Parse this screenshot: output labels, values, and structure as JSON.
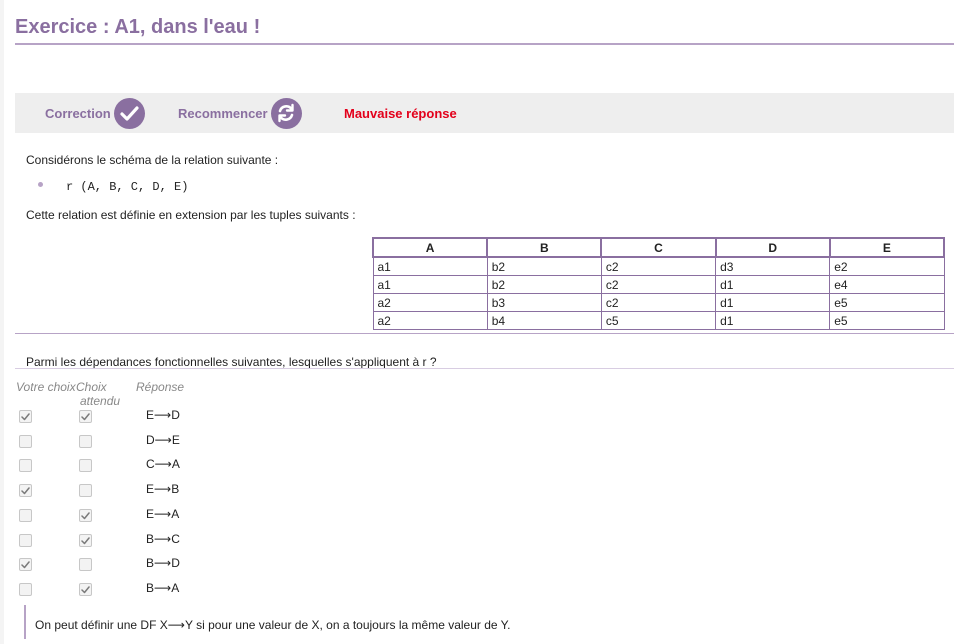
{
  "title": "Exercice : A1, dans l'eau !",
  "toolbar": {
    "correction_label": "Correction",
    "restart_label": "Recommencer",
    "status": "Mauvaise réponse"
  },
  "content": {
    "intro": "Considérons le schéma de la relation suivante :",
    "schema": "r (A, B, C, D, E)",
    "extension_text": "Cette relation est définie en extension par les tuples suivants :",
    "table": {
      "headers": [
        "A",
        "B",
        "C",
        "D",
        "E"
      ],
      "rows": [
        [
          "a1",
          "b2",
          "c2",
          "d3",
          "e2"
        ],
        [
          "a1",
          "b2",
          "c2",
          "d1",
          "e4"
        ],
        [
          "a2",
          "b3",
          "c2",
          "d1",
          "e5"
        ],
        [
          "a2",
          "b4",
          "c5",
          "d1",
          "e5"
        ]
      ]
    }
  },
  "question": {
    "text": "Parmi les dépendances fonctionnelles suivantes, lesquelles s'appliquent à r ?",
    "col_your_choice": "Votre choix",
    "col_expected_line1": "Choix",
    "col_expected_line2": "attendu",
    "col_answer": "Réponse",
    "answers": [
      {
        "label": "E⟶D",
        "your_choice": true,
        "expected": true
      },
      {
        "label": "D⟶E",
        "your_choice": false,
        "expected": false
      },
      {
        "label": "C⟶A",
        "your_choice": false,
        "expected": false
      },
      {
        "label": "E⟶B",
        "your_choice": true,
        "expected": false
      },
      {
        "label": "E⟶A",
        "your_choice": false,
        "expected": true
      },
      {
        "label": "B⟶C",
        "your_choice": false,
        "expected": true
      },
      {
        "label": "B⟶D",
        "your_choice": true,
        "expected": false
      },
      {
        "label": "B⟶A",
        "your_choice": false,
        "expected": true
      }
    ]
  },
  "explanation": "On peut définir une DF X⟶Y si pour une valeur de X, on a toujours la même valeur de Y.",
  "colors": {
    "accent": "#8a6fa0",
    "error": "#e3001b"
  }
}
